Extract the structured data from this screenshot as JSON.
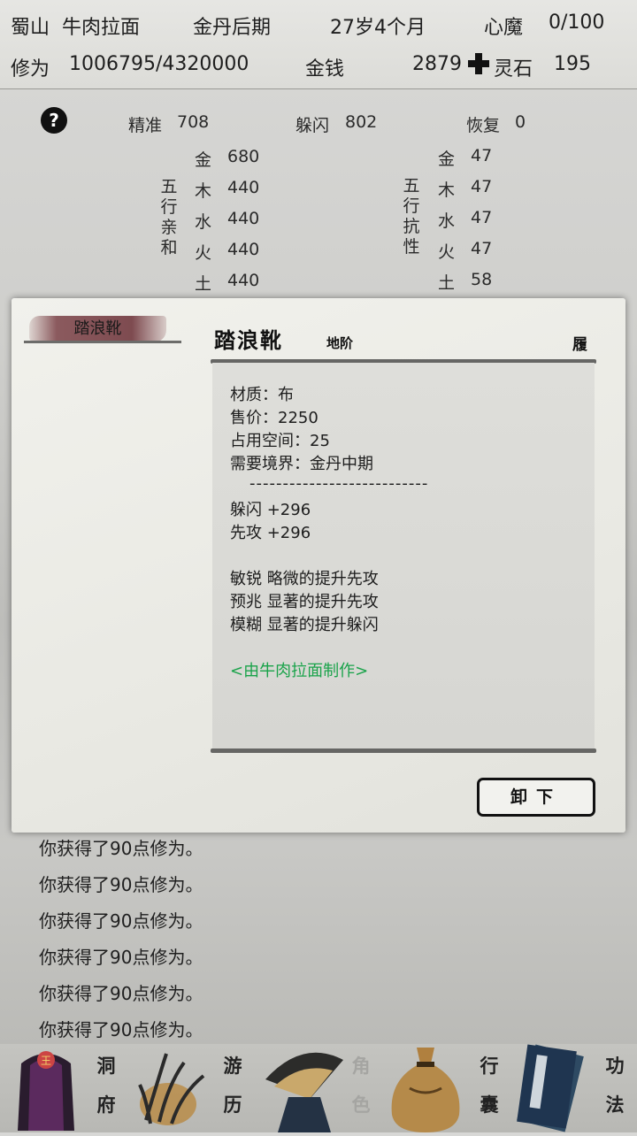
{
  "topbar": {
    "location": "蜀山",
    "name": "牛肉拉面",
    "realm": "金丹后期",
    "age": "27岁4个月",
    "heart_demon_label": "心魔",
    "heart_demon_value": "0/100",
    "cultivation_label": "修为",
    "cultivation_value": "1006795/4320000",
    "money_label": "金钱",
    "money_value": "2879",
    "spirit_stone_label": "灵石",
    "spirit_stone_value": "195"
  },
  "stats": {
    "accuracy_label": "精准",
    "accuracy_value": "708",
    "dodge_label": "躲闪",
    "dodge_value": "802",
    "recover_label": "恢复",
    "recover_value": "0",
    "affinity_title": [
      "五",
      "行",
      "亲",
      "和"
    ],
    "resist_title": [
      "五",
      "行",
      "抗",
      "性"
    ],
    "affinity": [
      {
        "el": "金",
        "v": "680"
      },
      {
        "el": "木",
        "v": "440"
      },
      {
        "el": "水",
        "v": "440"
      },
      {
        "el": "火",
        "v": "440"
      },
      {
        "el": "土",
        "v": "440"
      }
    ],
    "resist": [
      {
        "el": "金",
        "v": "47"
      },
      {
        "el": "木",
        "v": "47"
      },
      {
        "el": "水",
        "v": "47"
      },
      {
        "el": "火",
        "v": "47"
      },
      {
        "el": "土",
        "v": "58"
      }
    ]
  },
  "modal": {
    "tab_label": "踏浪靴",
    "item_name": "踏浪靴",
    "item_grade": "地阶",
    "item_slot": "履",
    "lines": [
      "材质：布",
      "售价：2250",
      "占用空间：25",
      "需要境界：金丹中期",
      "---------------------------",
      "躲闪 +296",
      "先攻 +296",
      "敏锐 略微的提升先攻",
      "预兆 显著的提升先攻",
      "模糊 显著的提升躲闪"
    ],
    "crafter": "<由牛肉拉面制作>",
    "unequip_label": "卸下"
  },
  "log": [
    "你获得了90点修为。",
    "你获得了90点修为。",
    "你获得了90点修为。",
    "你获得了90点修为。",
    "你获得了90点修为。",
    "你获得了90点修为。"
  ],
  "nav": {
    "cave_top": "洞",
    "cave_bottom": "府",
    "travel_top": "游",
    "travel_bottom": "历",
    "role_top": "角",
    "role_bottom": "色",
    "bag_top": "行",
    "bag_bottom": "囊",
    "skill_top": "功",
    "skill_bottom": "法"
  },
  "colors": {
    "crafter_green": "#1aa34a",
    "tab_brush": "#7e4b50"
  }
}
